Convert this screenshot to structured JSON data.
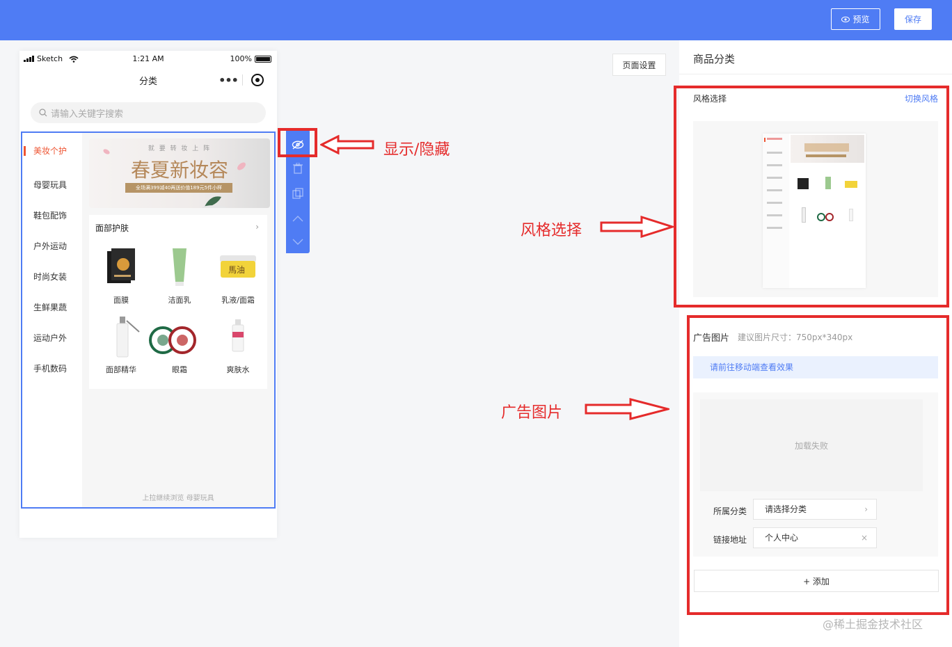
{
  "header": {
    "preview_label": "预览",
    "save_label": "保存"
  },
  "phone": {
    "status": {
      "carrier": "Sketch",
      "time": "1:21 AM",
      "battery": "100%"
    },
    "nav_title": "分类",
    "search_placeholder": "请输入关键字搜索",
    "categories": [
      "美妆个护",
      "母婴玩具",
      "鞋包配饰",
      "户外运动",
      "时尚女装",
      "生鲜果蔬",
      "运动户外",
      "手机数码"
    ],
    "active_category": "美妆个护",
    "banner": {
      "top_text": "就 要 转 妆 上 阵",
      "title": "春夏新妆容",
      "strip": "全场满399减40再送价值189元5件小样"
    },
    "panel_title": "面部护肤",
    "products": [
      {
        "name": "面膜",
        "icon": "mask-box-icon"
      },
      {
        "name": "洁面乳",
        "icon": "cleanser-tube-icon"
      },
      {
        "name": "乳液/面霜",
        "icon": "cream-jar-icon"
      },
      {
        "name": "面部精华",
        "icon": "serum-bottle-icon"
      },
      {
        "name": "眼霜",
        "icon": "eye-cream-icon"
      },
      {
        "name": "爽肤水",
        "icon": "toner-bottle-icon"
      }
    ],
    "footer_tip": "上拉继续浏览 母婴玩具"
  },
  "toolbar": {
    "icons": [
      "eye-off-icon",
      "trash-icon",
      "copy-icon",
      "arrow-up-icon",
      "arrow-down-icon"
    ]
  },
  "annotations": {
    "show_hide": "显示/隐藏",
    "style_select": "风格选择",
    "ad_image": "广告图片"
  },
  "page_settings_label": "页面设置",
  "right_panel": {
    "title": "商品分类",
    "style_section": {
      "label": "风格选择",
      "switch_link": "切换风格"
    },
    "ad_section": {
      "label": "广告图片",
      "size_hint": "建议图片尺寸：750px*340px",
      "notice": "请前往移动端查看效果",
      "load_failed": "加载失败",
      "category_label": "所属分类",
      "category_placeholder": "请选择分类",
      "link_label": "链接地址",
      "link_value": "个人中心",
      "add_label": "+ 添加"
    }
  },
  "watermark": "@稀土掘金技术社区",
  "colors": {
    "primary": "#4f7cf4",
    "annotation_red": "#e52b2b",
    "active_category": "#ee5533",
    "banner_gold": "#b5885a"
  }
}
